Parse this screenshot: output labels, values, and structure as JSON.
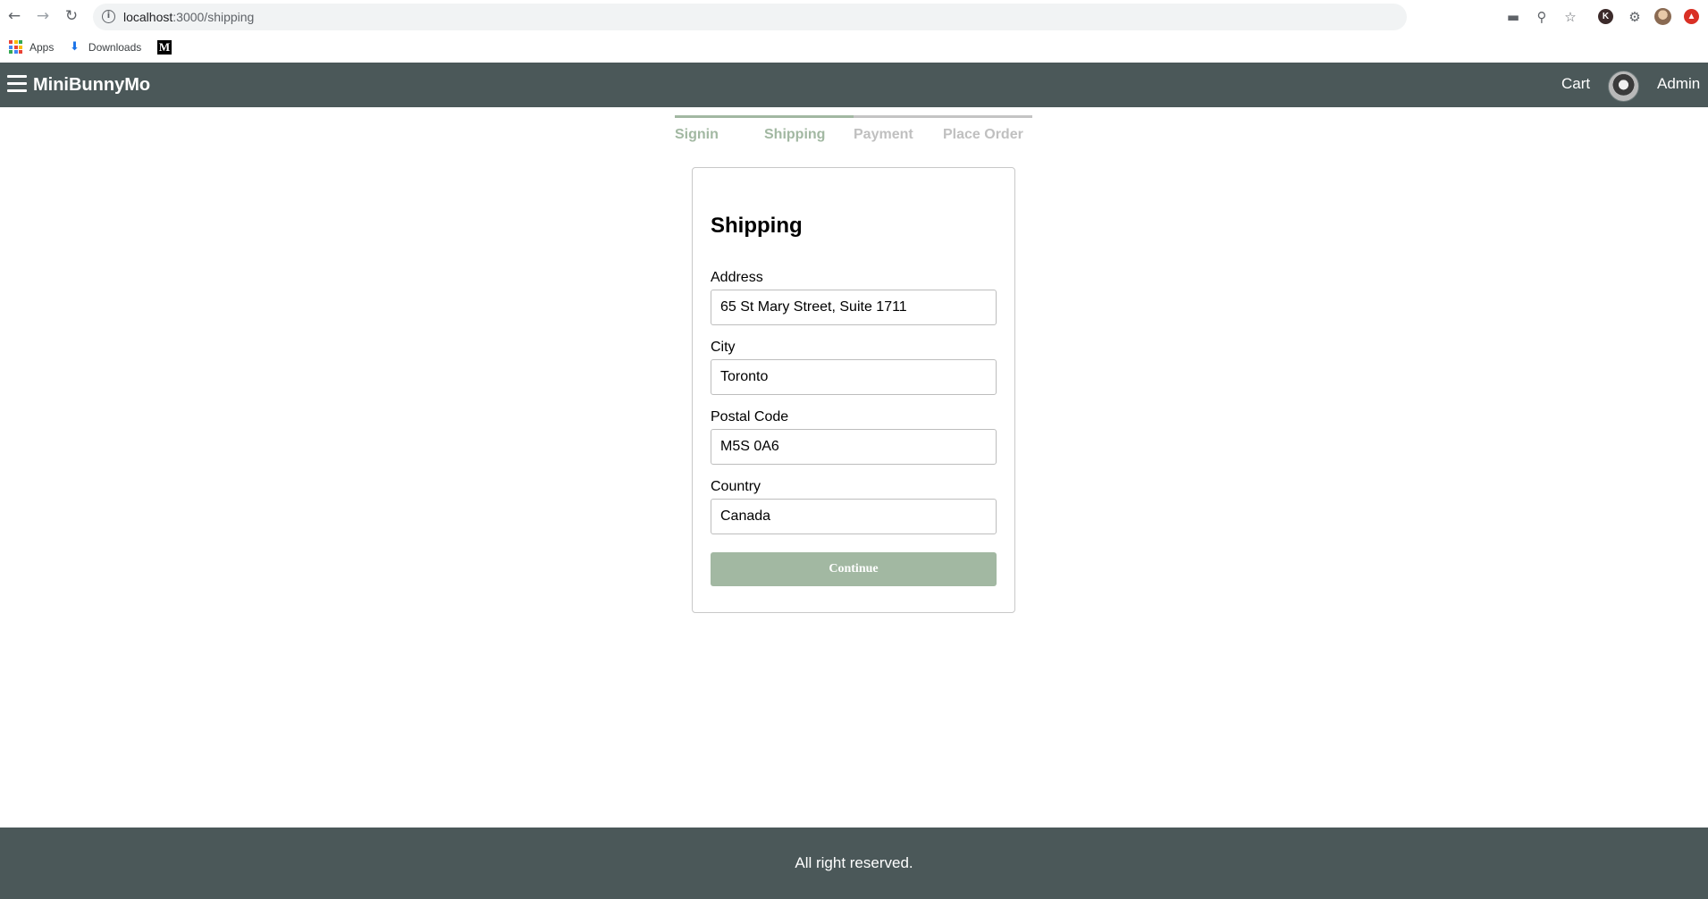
{
  "browser": {
    "url_host": "localhost",
    "url_path": ":3000/shipping",
    "bookmarks": [
      {
        "label": "Apps"
      },
      {
        "label": "Downloads"
      },
      {
        "label": "M"
      }
    ],
    "profile_initial": "K"
  },
  "header": {
    "brand": "MiniBunnyMo",
    "cart_label": "Cart",
    "user_label": "Admin"
  },
  "steps": [
    {
      "label": "Signin",
      "active": true
    },
    {
      "label": "Shipping",
      "active": true
    },
    {
      "label": "Payment",
      "active": false
    },
    {
      "label": "Place Order",
      "active": false
    }
  ],
  "form": {
    "title": "Shipping",
    "fields": [
      {
        "label": "Address",
        "value": "65 St Mary Street, Suite 1711"
      },
      {
        "label": "City",
        "value": "Toronto"
      },
      {
        "label": "Postal Code",
        "value": "M5S 0A6"
      },
      {
        "label": "Country",
        "value": "Canada"
      }
    ],
    "submit_label": "Continue"
  },
  "footer": {
    "text": "All right reserved."
  },
  "colors": {
    "header_bg": "#4b5859",
    "accent": "#a2b8a2",
    "inactive_step": "#c0c0c0"
  }
}
